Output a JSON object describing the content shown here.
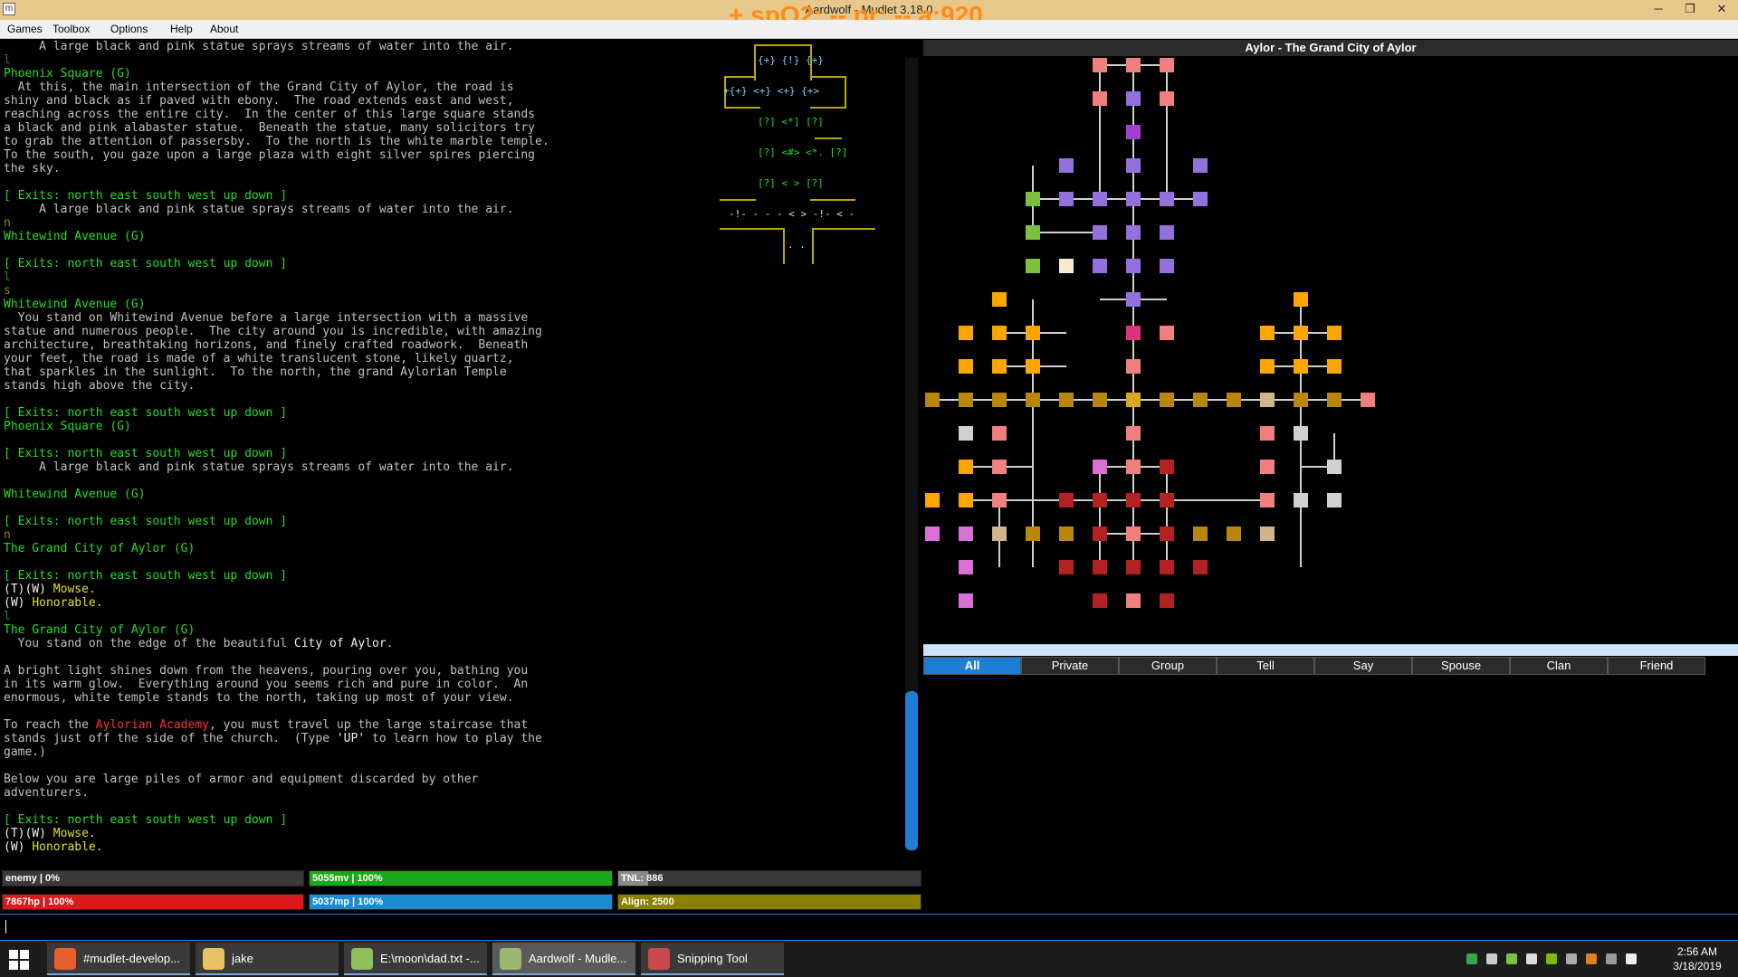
{
  "window": {
    "title": "Aardwolf - Mudlet 3.18.0",
    "overlay_text": "+ spO2: -- pr: -- a:920",
    "minimize": "─",
    "restore": "❐",
    "close": "✕"
  },
  "menu": [
    "Games",
    "Toolbox",
    "Options",
    "Help",
    "About"
  ],
  "terminal": {
    "lines": [
      [
        {
          "t": "     A large black and pink statue sprays streams of water into the air.",
          "c": ""
        }
      ],
      [
        {
          "t": "l",
          "c": "dg"
        }
      ],
      [
        {
          "t": "Phoenix Square (G)",
          "c": "g"
        }
      ],
      [
        {
          "t": "  At this, the main intersection of the Grand City of Aylor, the road is",
          "c": ""
        }
      ],
      [
        {
          "t": "shiny and black as if paved with ebony.  The road extends east and west,",
          "c": ""
        }
      ],
      [
        {
          "t": "reaching across the entire city.  In the center of this large square stands",
          "c": ""
        }
      ],
      [
        {
          "t": "a black and pink alabaster statue.  Beneath the statue, many solicitors try",
          "c": ""
        }
      ],
      [
        {
          "t": "to grab the attention of passersby.  To the north is the white marble temple.",
          "c": ""
        }
      ],
      [
        {
          "t": "To the south, you gaze upon a large plaza with eight silver spires piercing",
          "c": ""
        }
      ],
      [
        {
          "t": "the sky.",
          "c": ""
        }
      ],
      [
        {
          "t": "",
          "c": ""
        }
      ],
      [
        {
          "t": "[ Exits: north east south west up down ]",
          "c": "g"
        }
      ],
      [
        {
          "t": "     A large black and pink statue sprays streams of water into the air.",
          "c": ""
        }
      ],
      [
        {
          "t": "n",
          "c": "dy"
        }
      ],
      [
        {
          "t": "Whitewind Avenue (G)",
          "c": "g"
        }
      ],
      [
        {
          "t": "",
          "c": ""
        }
      ],
      [
        {
          "t": "[ Exits: north east south west up down ]",
          "c": "g"
        }
      ],
      [
        {
          "t": "l",
          "c": "dg"
        }
      ],
      [
        {
          "t": "s",
          "c": "dy"
        }
      ],
      [
        {
          "t": "Whitewind Avenue (G)",
          "c": "g"
        }
      ],
      [
        {
          "t": "  You stand on Whitewind Avenue before a large intersection with a massive",
          "c": ""
        }
      ],
      [
        {
          "t": "statue and numerous people.  The city around you is incredible, with amazing",
          "c": ""
        }
      ],
      [
        {
          "t": "architecture, breathtaking horizons, and finely crafted roadwork.  Beneath",
          "c": ""
        }
      ],
      [
        {
          "t": "your feet, the road is made of a white translucent stone, likely quartz,",
          "c": ""
        }
      ],
      [
        {
          "t": "that sparkles in the sunlight.  To the north, the grand Aylorian Temple",
          "c": ""
        }
      ],
      [
        {
          "t": "stands high above the city.",
          "c": ""
        }
      ],
      [
        {
          "t": "",
          "c": ""
        }
      ],
      [
        {
          "t": "[ Exits: north east south west up down ]",
          "c": "g"
        }
      ],
      [
        {
          "t": "Phoenix Square (G)",
          "c": "g"
        }
      ],
      [
        {
          "t": "",
          "c": ""
        }
      ],
      [
        {
          "t": "[ Exits: north east south west up down ]",
          "c": "g"
        }
      ],
      [
        {
          "t": "     A large black and pink statue sprays streams of water into the air.",
          "c": ""
        }
      ],
      [
        {
          "t": "",
          "c": ""
        }
      ],
      [
        {
          "t": "Whitewind Avenue (G)",
          "c": "g"
        }
      ],
      [
        {
          "t": "",
          "c": ""
        }
      ],
      [
        {
          "t": "[ Exits: north east south west up down ]",
          "c": "g"
        }
      ],
      [
        {
          "t": "n",
          "c": "dy"
        }
      ],
      [
        {
          "t": "The Grand City of Aylor (G)",
          "c": "g"
        }
      ],
      [
        {
          "t": "",
          "c": ""
        }
      ],
      [
        {
          "t": "[ Exits: north east south west up down ]",
          "c": "g"
        }
      ],
      [
        {
          "t": "(T)(W) ",
          "c": "w"
        },
        {
          "t": "Mowse.",
          "c": "y"
        }
      ],
      [
        {
          "t": "(W) ",
          "c": "w"
        },
        {
          "t": "Honorable.",
          "c": "y"
        }
      ],
      [
        {
          "t": "l",
          "c": "dg"
        }
      ],
      [
        {
          "t": "The Grand City of Aylor (G)",
          "c": "g"
        }
      ],
      [
        {
          "t": "  You stand on the edge of the beautiful ",
          "c": ""
        },
        {
          "t": "City of Aylor",
          "c": "w"
        },
        {
          "t": ".",
          "c": ""
        }
      ],
      [
        {
          "t": "",
          "c": ""
        }
      ],
      [
        {
          "t": "A bright light shines down from the heavens, pouring over you, bathing you",
          "c": ""
        }
      ],
      [
        {
          "t": "in its warm glow.  Everything around you seems rich and pure in color.  An",
          "c": ""
        }
      ],
      [
        {
          "t": "enormous, white temple stands to the north, taking up most of your view.",
          "c": ""
        }
      ],
      [
        {
          "t": "",
          "c": ""
        }
      ],
      [
        {
          "t": "To reach the ",
          "c": ""
        },
        {
          "t": "Aylorian Academy",
          "c": "r"
        },
        {
          "t": ", you must travel up the large staircase that",
          "c": ""
        }
      ],
      [
        {
          "t": "stands just off the side of the church.  (Type ",
          "c": ""
        },
        {
          "t": "'UP'",
          "c": "w"
        },
        {
          "t": " to learn how to play the",
          "c": ""
        }
      ],
      [
        {
          "t": "game.)",
          "c": ""
        }
      ],
      [
        {
          "t": "",
          "c": ""
        }
      ],
      [
        {
          "t": "Below you are large piles of armor and equipment discarded by other",
          "c": ""
        }
      ],
      [
        {
          "t": "adventurers.",
          "c": ""
        }
      ],
      [
        {
          "t": "",
          "c": ""
        }
      ],
      [
        {
          "t": "[ Exits: north east south west up down ]",
          "c": "g"
        }
      ],
      [
        {
          "t": "(T)(W) ",
          "c": "w"
        },
        {
          "t": "Mowse.",
          "c": "y"
        }
      ],
      [
        {
          "t": "(W) ",
          "c": "w"
        },
        {
          "t": "Honorable.",
          "c": "y"
        }
      ]
    ]
  },
  "minimap": {
    "r1": "{+} {!} {+}",
    "r2": "+{+} <+} <+} {+>",
    "r3": "[?] <*] [?]",
    "r4": "[?] <#> <*. [?]",
    "r5": "[?] < > [?]",
    "r6": "-!- - - - < > -!- < -",
    "r7": ". ."
  },
  "map": {
    "title": "Aylor - The Grand City of Aylor"
  },
  "tabs": {
    "active": "All",
    "items": [
      "All",
      "Private",
      "Group",
      "Tell",
      "Say",
      "Spouse",
      "Clan",
      "Friend"
    ]
  },
  "gauges": [
    {
      "label": "enemy | 0%",
      "fill": 0,
      "color": "#8a8a8a"
    },
    {
      "label": "5055mv | 100%",
      "fill": 1,
      "color": "#1aa81a"
    },
    {
      "label": "TNL: 886",
      "fill": 0.1,
      "color": "#8a8a8a"
    },
    {
      "label": "7867hp | 100%",
      "fill": 1,
      "color": "#d81a1a"
    },
    {
      "label": "5037mp | 100%",
      "fill": 1,
      "color": "#1a8ccf"
    },
    {
      "label": "Align: 2500",
      "fill": 1,
      "color": "#8a8000"
    }
  ],
  "taskbar": {
    "items": [
      {
        "label": "#mudlet-develop...",
        "icon_color": "#e8612c",
        "icon": "firefox-icon"
      },
      {
        "label": "jake",
        "icon_color": "#e8c264",
        "icon": "folder-icon"
      },
      {
        "label": "E:\\moon\\dad.txt -...",
        "icon_color": "#8fbf5a",
        "icon": "notepad-icon"
      },
      {
        "label": "Aardwolf - Mudle...",
        "icon_color": "#9ab870",
        "icon": "mudlet-icon"
      },
      {
        "label": "Snipping Tool",
        "icon_color": "#c94a4a",
        "icon": "scissors-icon"
      }
    ],
    "active_index": 3,
    "time": "2:56 AM",
    "date": "3/18/2019"
  }
}
